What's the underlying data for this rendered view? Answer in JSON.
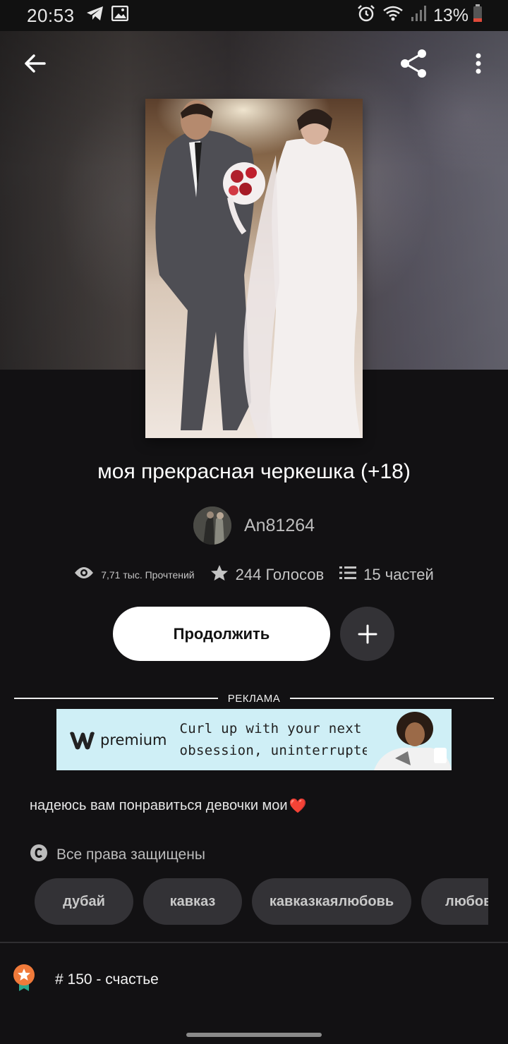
{
  "status_bar": {
    "time": "20:53",
    "battery": "13%",
    "icons": [
      "telegram-icon",
      "gallery-icon",
      "alarm-icon",
      "wifi-icon",
      "signal-icon",
      "battery-icon"
    ]
  },
  "header": {
    "back_icon": "back-arrow-icon",
    "share_icon": "share-icon",
    "menu_icon": "more-vertical-icon"
  },
  "story": {
    "title": "моя прекрасная черкешка (+18)",
    "author": "An81264",
    "reads": "7,71 тыс. Прочтений",
    "votes": "244 Голосов",
    "parts": "15 частей",
    "continue_label": "Продолжить",
    "description": "надеюсь вам понравиться девочки мои",
    "description_emoji": "❤️",
    "copyright": "Все права защищены",
    "tags": [
      "дубай",
      "кавказ",
      "кавказкаялюбовь",
      "любов"
    ],
    "ranking": "# 150 - счастье"
  },
  "ad": {
    "label": "РЕКЛАМА",
    "brand": "premium",
    "line1": "Curl up with your next reading",
    "line2": "obsession, uninterrupted."
  },
  "colors": {
    "background": "#121113",
    "button_dark": "#333236",
    "ad_background": "#cfeff6",
    "ranking_badge": "#f07a3a"
  }
}
